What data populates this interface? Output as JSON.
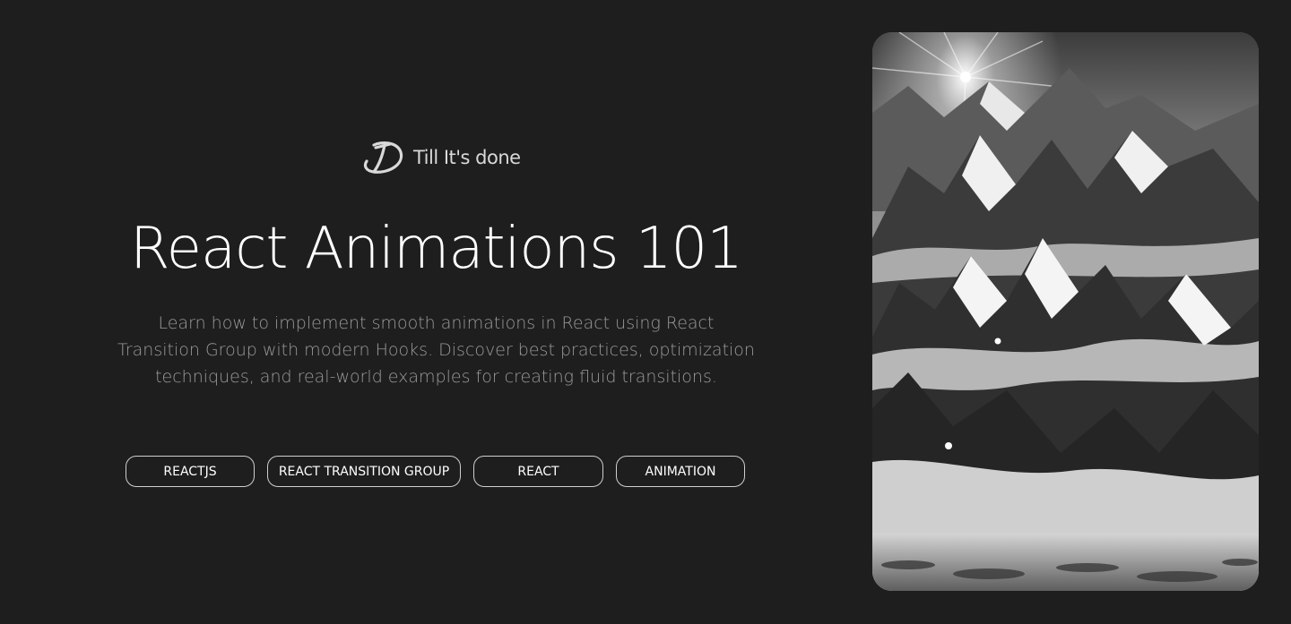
{
  "brand": {
    "name": "Till It's done",
    "logo_icon": "td-monogram-icon"
  },
  "hero": {
    "title": "React Animations 101",
    "description": "Learn how to implement smooth animations in React using React Transition Group with modern Hooks. Discover best practices, optimization techniques, and real-world examples for creating fluid transitions."
  },
  "tags": [
    "REACTJS",
    "REACT TRANSITION GROUP",
    "REACT",
    "ANIMATION"
  ],
  "image": {
    "subject": "snowy-mountains-image"
  },
  "colors": {
    "background": "#1e1e1e",
    "text": "#ffffff",
    "muted_text": "#9a9a9a",
    "tag_border": "#cfcfcf"
  }
}
